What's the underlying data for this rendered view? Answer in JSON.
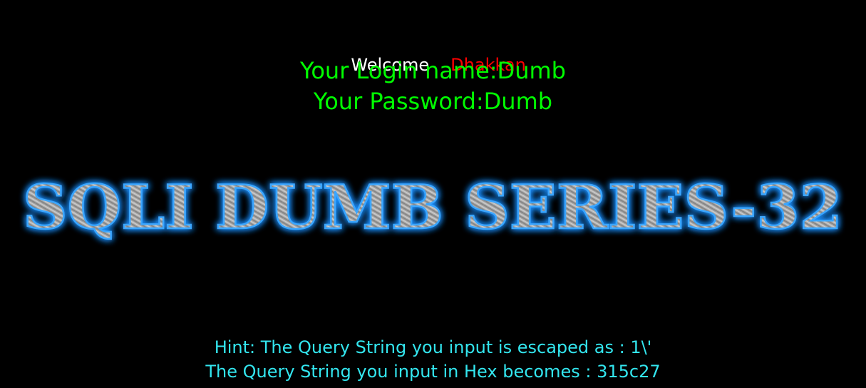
{
  "welcome": {
    "label": "Welcome",
    "name": "Dhakkan"
  },
  "login": {
    "name_line": "Your Login name:Dumb",
    "password_line": "Your Password:Dumb"
  },
  "banner": {
    "title": "SQLI DUMB SERIES-32"
  },
  "hints": {
    "escaped_line": "Hint: The Query String you input is escaped as : 1\\'",
    "hex_line": "The Query String you input in Hex becomes : 315c27"
  },
  "colors": {
    "background": "#000000",
    "welcome_text": "#ffffff",
    "name_text": "#ff0000",
    "login_text": "#00ff00",
    "hint_text": "#33e6ef",
    "banner_glow": "#1e90ff",
    "banner_metal": "#9a9a9a"
  }
}
